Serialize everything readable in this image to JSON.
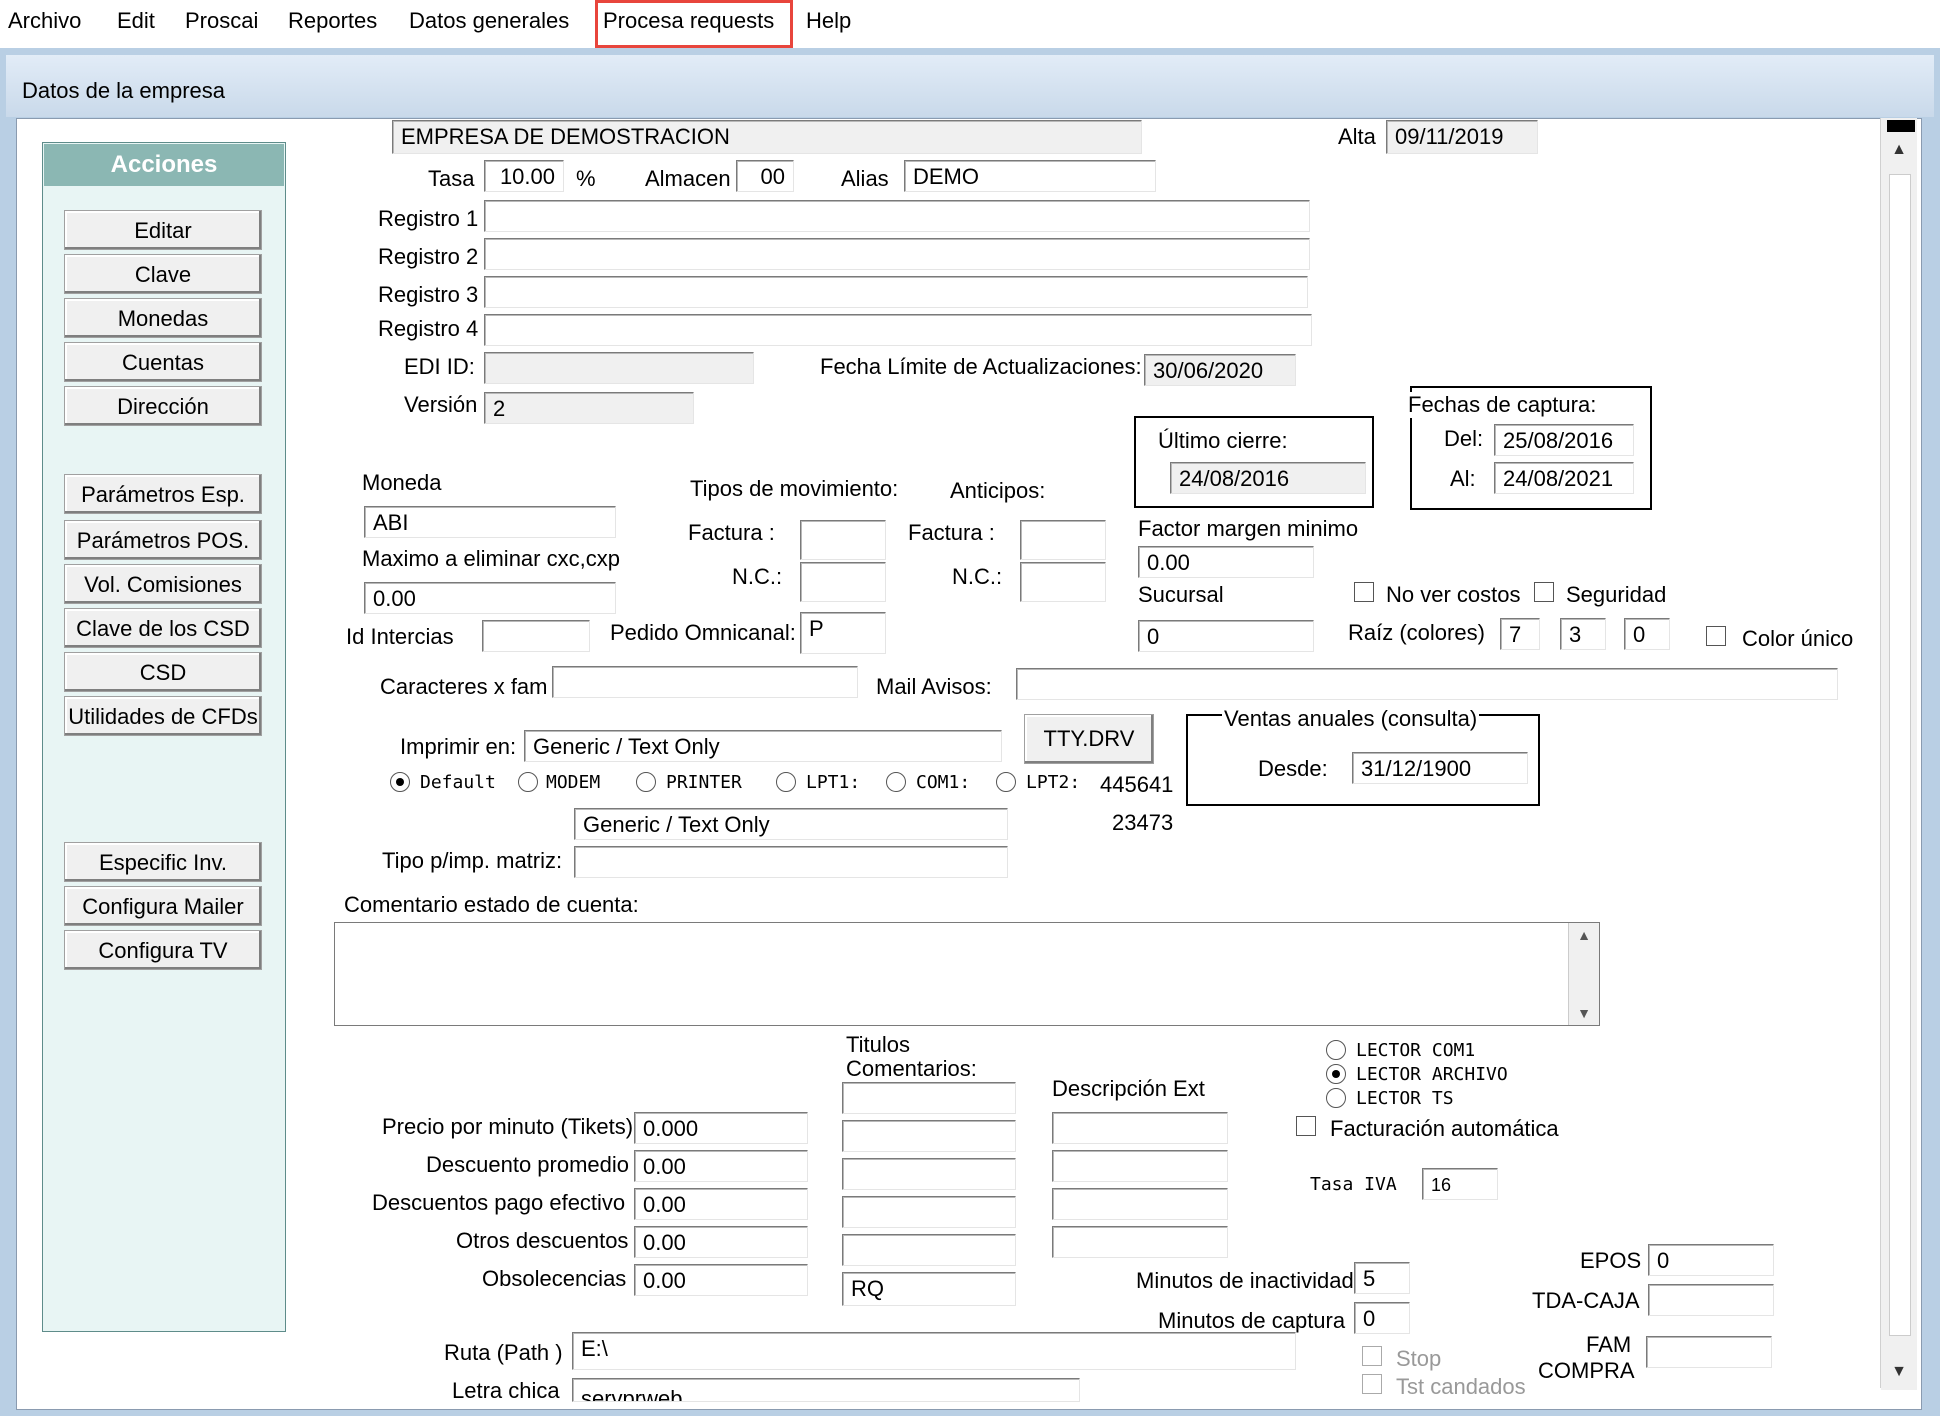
{
  "menu": [
    "Archivo",
    "Edit",
    "Proscai",
    "Reportes",
    "Datos generales",
    "Procesa requests",
    "Help"
  ],
  "window": {
    "title": "Datos de la empresa"
  },
  "actions": {
    "header": "Acciones",
    "group1": [
      "Editar",
      "Clave",
      "Monedas",
      "Cuentas",
      "Dirección"
    ],
    "group2": [
      "Parámetros Esp.",
      "Parámetros POS.",
      "Vol. Comisiones",
      "Clave de los CSD",
      "CSD",
      "Utilidades de CFDs"
    ],
    "group3": [
      "Especific Inv.",
      "Configura Mailer",
      "Configura TV"
    ]
  },
  "form": {
    "empresa": "EMPRESA DE DEMOSTRACION",
    "alta_label": "Alta",
    "alta": "09/11/2019",
    "tasa_label": "Tasa",
    "tasa": "10.00",
    "pct": "%",
    "almacen_label": "Almacen",
    "almacen": "00",
    "alias_label": "Alias",
    "alias": "DEMO",
    "reg1_label": "Registro 1",
    "reg2_label": "Registro 2",
    "reg3_label": "Registro 3",
    "reg4_label": "Registro 4",
    "edi_label": "EDI ID:",
    "fecha_limite_label": "Fecha Límite de Actualizaciones:",
    "fecha_limite": "30/06/2020",
    "version_label": "Versión",
    "version": "2",
    "ultimo_cierre_label": "Último cierre:",
    "ultimo_cierre": "24/08/2016",
    "fechas_captura_label": "Fechas de captura:",
    "del_label": "Del:",
    "del": "25/08/2016",
    "al_label": "Al:",
    "al": "24/08/2021",
    "moneda_label": "Moneda",
    "moneda": "ABI",
    "maximo_label": "Maximo a eliminar cxc,cxp",
    "maximo": "0.00",
    "id_intercias_label": "Id Intercias",
    "tipos_mov_label": "Tipos de movimiento:",
    "factura_label": "Factura :",
    "nc_label": "N.C.:",
    "anticipos_label": "Anticipos:",
    "pedido_label": "Pedido Omnicanal:",
    "pedido": "P",
    "factor_label": "Factor margen minimo",
    "factor": "0.00",
    "sucursal_label": "Sucursal",
    "sucursal": "0",
    "no_ver_costos": "No ver costos",
    "seguridad": "Seguridad",
    "raiz_label": "Raíz (colores)",
    "raiz1": "7",
    "raiz2": "3",
    "raiz3": "0",
    "color_unico": "Color único",
    "caracteres_label": "Caracteres x fam",
    "mail_label": "Mail Avisos:",
    "imprimir_label": "Imprimir en:",
    "imprimir": "Generic / Text Only",
    "tty": "TTY.DRV",
    "radios": [
      "Default",
      "MODEM",
      "PRINTER",
      "LPT1:",
      "COM1:",
      "LPT2:"
    ],
    "num1": "445641",
    "num2": "23473",
    "ventas_label": "Ventas anuales (consulta)",
    "desde_label": "Desde:",
    "desde": "31/12/1900",
    "matriz_printer": "Generic / Text Only",
    "tipo_matriz_label": "Tipo p/imp. matriz:",
    "comentario_label": "Comentario estado de cuenta:",
    "titulos_label": "Titulos\nComentarios:",
    "titulos_l1": "Titulos",
    "titulos_l2": "Comentarios:",
    "descripcion_label": "Descripción Ext",
    "precio_label": "Precio por minuto (Tikets)",
    "precio": "0.000",
    "desc_prom_label": "Descuento promedio",
    "desc_prom": "0.00",
    "desc_pago_label": "Descuentos pago efectivo",
    "desc_pago": "0.00",
    "otros_label": "Otros descuentos",
    "otros": "0.00",
    "obsol_label": "Obsolecencias",
    "obsol": "0.00",
    "rq": "RQ",
    "lector": [
      "LECTOR COM1",
      "LECTOR ARCHIVO",
      "LECTOR TS"
    ],
    "facturacion": "Facturación automática",
    "tasa_iva_label": "Tasa IVA",
    "tasa_iva": "16",
    "min_inact_label": "Minutos de inactividad",
    "min_inact": "5",
    "min_captura_label": "Minutos de captura",
    "min_captura": "0",
    "epos_label": "EPOS",
    "epos": "0",
    "tda_label": "TDA-CAJA",
    "fam_l1": "FAM",
    "fam_l2": "COMPRA",
    "ruta_label": "Ruta (Path )",
    "ruta": "E:\\",
    "letra_label": "Letra chica",
    "letra": "servprweb",
    "stop": "Stop",
    "tst": "Tst candados"
  }
}
